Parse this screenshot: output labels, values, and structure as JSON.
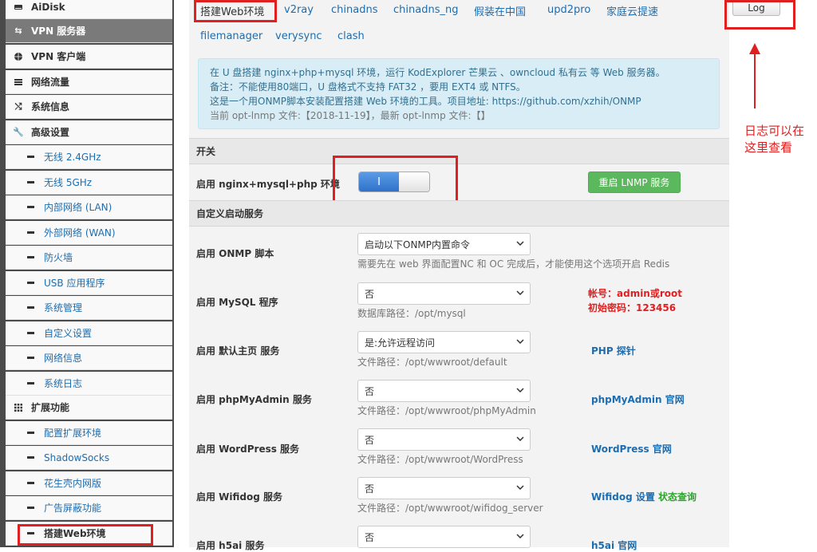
{
  "sidebar": {
    "items": [
      {
        "label": "AiDisk",
        "icon": "hard-drive-icon",
        "level": "top"
      },
      {
        "label": "VPN 服务器",
        "icon": "swap-arrows-icon",
        "level": "top",
        "active": true
      },
      {
        "label": "VPN 客户端",
        "icon": "globe-icon",
        "level": "top"
      },
      {
        "label": "网络流量",
        "icon": "list-icon",
        "level": "top"
      },
      {
        "label": "系统信息",
        "icon": "shuffle-icon",
        "level": "top"
      },
      {
        "label": "高级设置",
        "icon": "wrench-icon",
        "level": "top"
      },
      {
        "label": "无线 2.4GHz",
        "level": "sub"
      },
      {
        "label": "无线 5GHz",
        "level": "sub"
      },
      {
        "label": "内部网络 (LAN)",
        "level": "sub"
      },
      {
        "label": "外部网络 (WAN)",
        "level": "sub"
      },
      {
        "label": "防火墙",
        "level": "sub"
      },
      {
        "label": "USB 应用程序",
        "level": "sub"
      },
      {
        "label": "系统管理",
        "level": "sub"
      },
      {
        "label": "自定义设置",
        "level": "sub"
      },
      {
        "label": "网络信息",
        "level": "sub"
      },
      {
        "label": "系统日志",
        "level": "sub"
      },
      {
        "label": "扩展功能",
        "icon": "grid-icon",
        "level": "top"
      },
      {
        "label": "配置扩展环境",
        "level": "sub"
      },
      {
        "label": "ShadowSocks",
        "level": "sub"
      },
      {
        "label": "花生壳内网版",
        "level": "sub"
      },
      {
        "label": "广告屏蔽功能",
        "level": "sub"
      },
      {
        "label": "搭建Web环境",
        "level": "sub",
        "current": true
      }
    ]
  },
  "tabs": [
    {
      "label": "搭建Web环境",
      "active": true
    },
    {
      "label": "v2ray"
    },
    {
      "label": "chinadns"
    },
    {
      "label": "chinadns_ng"
    },
    {
      "label": "假装在中国"
    },
    {
      "label": "upd2pro"
    },
    {
      "label": "家庭云提速"
    },
    {
      "label": "filemanager"
    },
    {
      "label": "verysync"
    },
    {
      "label": "clash"
    }
  ],
  "info": {
    "line1": "在 U 盘搭建 nginx+php+mysql 环境，运行 KodExplorer 芒果云 、owncloud 私有云 等 Web 服务器。",
    "line2": "备注：不能使用80端口，U 盘格式不支持 FAT32 ，要用 EXT4 或 NTFS。",
    "line3": "这是一个用ONMP脚本安装配置搭建 Web 环境的工具。项目地址: https://github.com/xzhih/ONMP",
    "line4": "当前 opt-lnmp 文件:【2018-11-19】，最新 opt-lnmp 文件:【】"
  },
  "switch_section": {
    "title": "开关",
    "row_label": "启用 nginx+mysql+php 环境",
    "toggle_on_label": "I",
    "restart_button": "重启 LNMP 服务"
  },
  "custom_section": {
    "title": "自定义启动服务",
    "rows": [
      {
        "label": "启用 ONMP 脚本",
        "select": "启动以下ONMP内置命令",
        "help": "需要先在 web 界面配置NC 和 OC 完成后，才能使用这个选项开启 Redis"
      },
      {
        "label": "启用 MySQL 程序",
        "select": "否",
        "help": "数据库路径：/opt/mysql"
      },
      {
        "label": "启用 默认主页 服务",
        "select": "是:允许远程访问",
        "help": "文件路径：/opt/wwwroot/default",
        "link": "PHP 探针"
      },
      {
        "label": "启用 phpMyAdmin 服务",
        "select": "否",
        "help": "文件路径：/opt/wwwroot/phpMyAdmin",
        "link": "phpMyAdmin 官网"
      },
      {
        "label": "启用 WordPress 服务",
        "select": "否",
        "help": "文件路径：/opt/wwwroot/WordPress",
        "link": "WordPress 官网"
      },
      {
        "label": "启用 Wifidog 服务",
        "select": "否",
        "help": "文件路径：/opt/wwwroot/wifidog_server",
        "link": "Wifidog 设置",
        "link2": "状态查询"
      },
      {
        "label": "启用 h5ai 服务",
        "select": "否",
        "link": "h5ai 官网"
      }
    ],
    "mysql_account": "帐号：admin或root",
    "mysql_password": "初始密码：123456"
  },
  "log_button": "Log",
  "annotation": {
    "line1": "日志可以在",
    "line2": "这里查看"
  },
  "colors": {
    "link": "#1d6db0",
    "annotation_red": "#e02020",
    "success_green": "#5cb85c"
  }
}
